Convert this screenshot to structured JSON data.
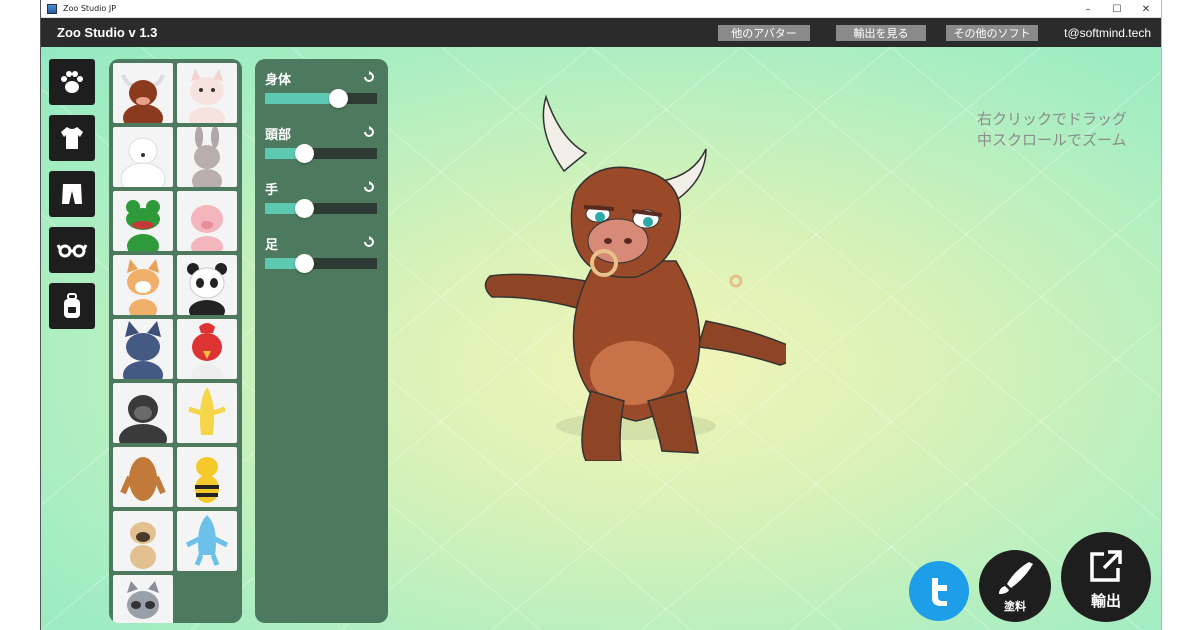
{
  "titlebar": {
    "title": "Zoo Studio JP",
    "minimize": "–",
    "maximize": "☐",
    "close": "✕"
  },
  "menubar": {
    "app_title": "Zoo Studio v 1.3",
    "buttons": [
      "他のアバター",
      "輸出を見る",
      "その他のソフト"
    ],
    "email": "t@softmind.tech"
  },
  "categories": [
    "paw-icon",
    "shirt-icon",
    "pants-icon",
    "glasses-icon",
    "backpack-icon"
  ],
  "avatars": [
    "bull",
    "cat",
    "polar-bear",
    "rabbit",
    "frog",
    "pig",
    "fox",
    "panda",
    "wolf",
    "rooster",
    "gorilla",
    "banana",
    "bigfoot",
    "bee",
    "pug",
    "shark",
    "raccoon"
  ],
  "sliders": [
    {
      "label": "身体",
      "value": 0.65
    },
    {
      "label": "頭部",
      "value": 0.35
    },
    {
      "label": "手",
      "value": 0.35
    },
    {
      "label": "足",
      "value": 0.35
    }
  ],
  "hint": {
    "line1": "右クリックでドラッグ",
    "line2": "中スクロールでズーム"
  },
  "actions": {
    "paint_label": "塗料",
    "export_label": "輸出"
  },
  "colors": {
    "panel": "#4d7a5f",
    "slider_fill": "#5ec9b2",
    "twitter": "#1e9de8",
    "menubar": "#2b2b2b"
  }
}
